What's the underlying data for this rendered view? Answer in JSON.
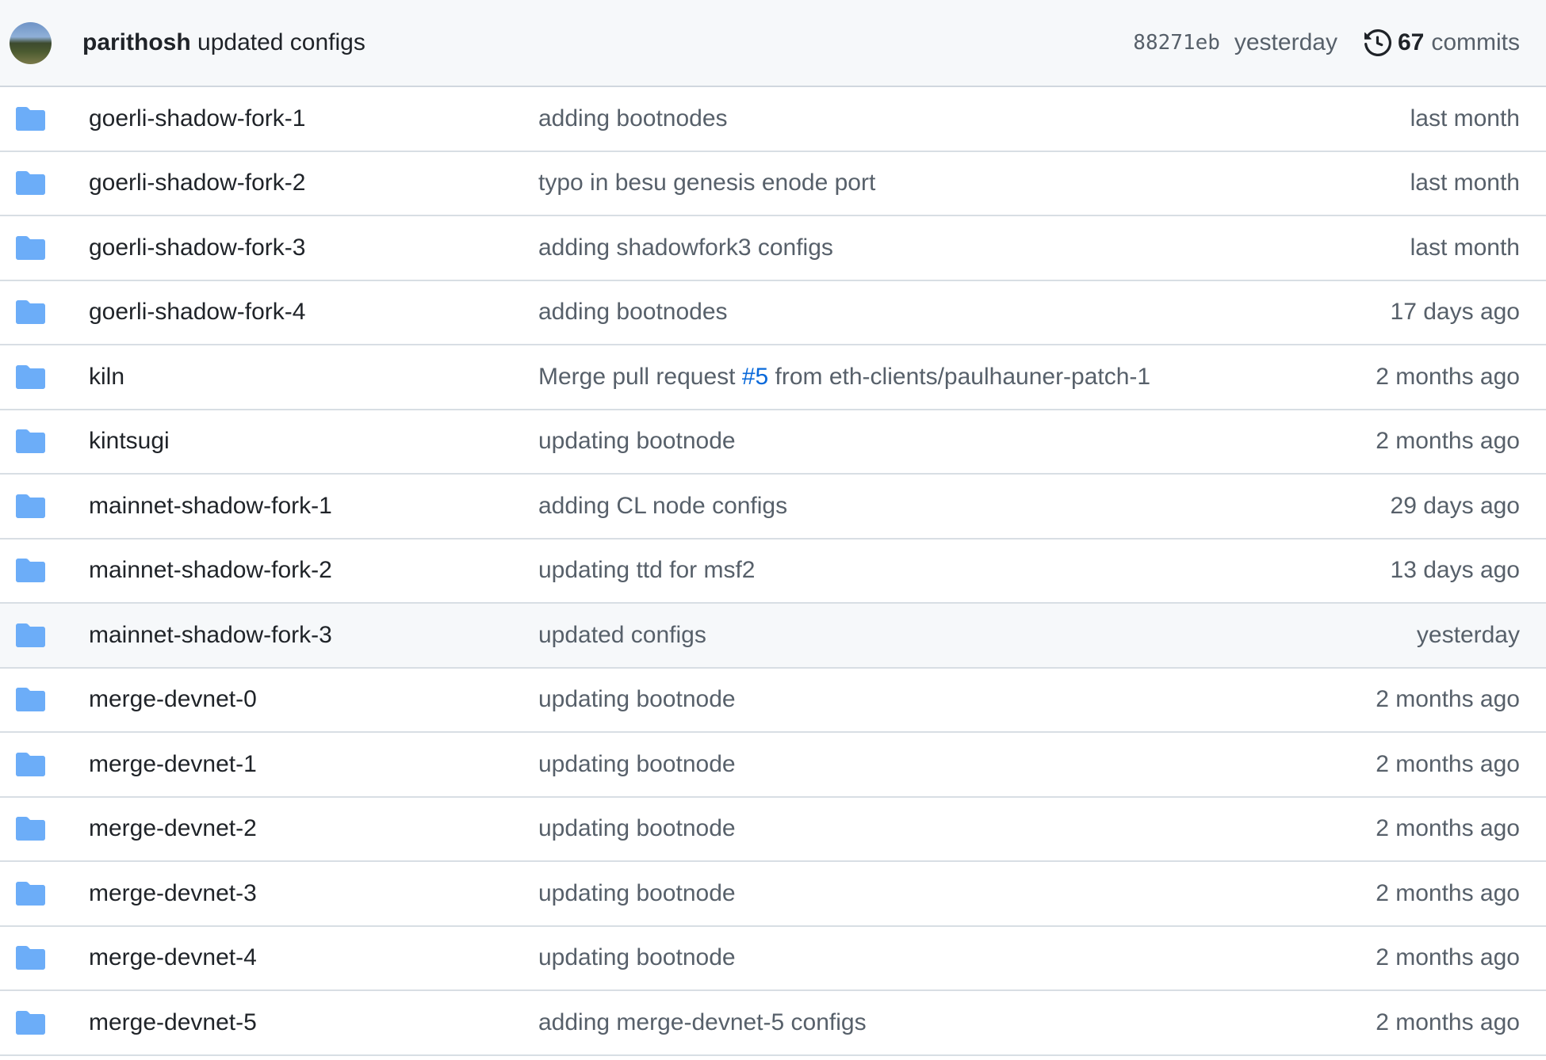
{
  "header": {
    "avatar_alt": "parithosh avatar",
    "author": "parithosh",
    "message": "updated configs",
    "sha": "88271eb",
    "when": "yesterday",
    "commits_count": "67",
    "commits_label": "commits",
    "history_icon": "history-icon"
  },
  "colors": {
    "folder": "#6cadf8",
    "link": "#0969da",
    "muted_text": "#57606a",
    "header_bg": "#f6f8fa",
    "highlight_bg": "#f6f8fa"
  },
  "rows": [
    {
      "name": "goerli-shadow-fork-1",
      "message": "adding bootnodes",
      "age": "last month"
    },
    {
      "name": "goerli-shadow-fork-2",
      "message": "typo in besu genesis enode port",
      "age": "last month"
    },
    {
      "name": "goerli-shadow-fork-3",
      "message": "adding shadowfork3 configs",
      "age": "last month"
    },
    {
      "name": "goerli-shadow-fork-4",
      "message": "adding bootnodes",
      "age": "17 days ago"
    },
    {
      "name": "kiln",
      "message_pre": "Merge pull request ",
      "message_link": "#5",
      "message_post": " from eth-clients/paulhauner-patch-1",
      "age": "2 months ago"
    },
    {
      "name": "kintsugi",
      "message": "updating bootnode",
      "age": "2 months ago"
    },
    {
      "name": "mainnet-shadow-fork-1",
      "message": "adding CL node configs",
      "age": "29 days ago"
    },
    {
      "name": "mainnet-shadow-fork-2",
      "message": "updating ttd for msf2",
      "age": "13 days ago"
    },
    {
      "name": "mainnet-shadow-fork-3",
      "message": "updated configs",
      "age": "yesterday",
      "highlighted": true
    },
    {
      "name": "merge-devnet-0",
      "message": "updating bootnode",
      "age": "2 months ago"
    },
    {
      "name": "merge-devnet-1",
      "message": "updating bootnode",
      "age": "2 months ago"
    },
    {
      "name": "merge-devnet-2",
      "message": "updating bootnode",
      "age": "2 months ago"
    },
    {
      "name": "merge-devnet-3",
      "message": "updating bootnode",
      "age": "2 months ago"
    },
    {
      "name": "merge-devnet-4",
      "message": "updating bootnode",
      "age": "2 months ago"
    },
    {
      "name": "merge-devnet-5",
      "message": "adding merge-devnet-5 configs",
      "age": "2 months ago"
    }
  ]
}
